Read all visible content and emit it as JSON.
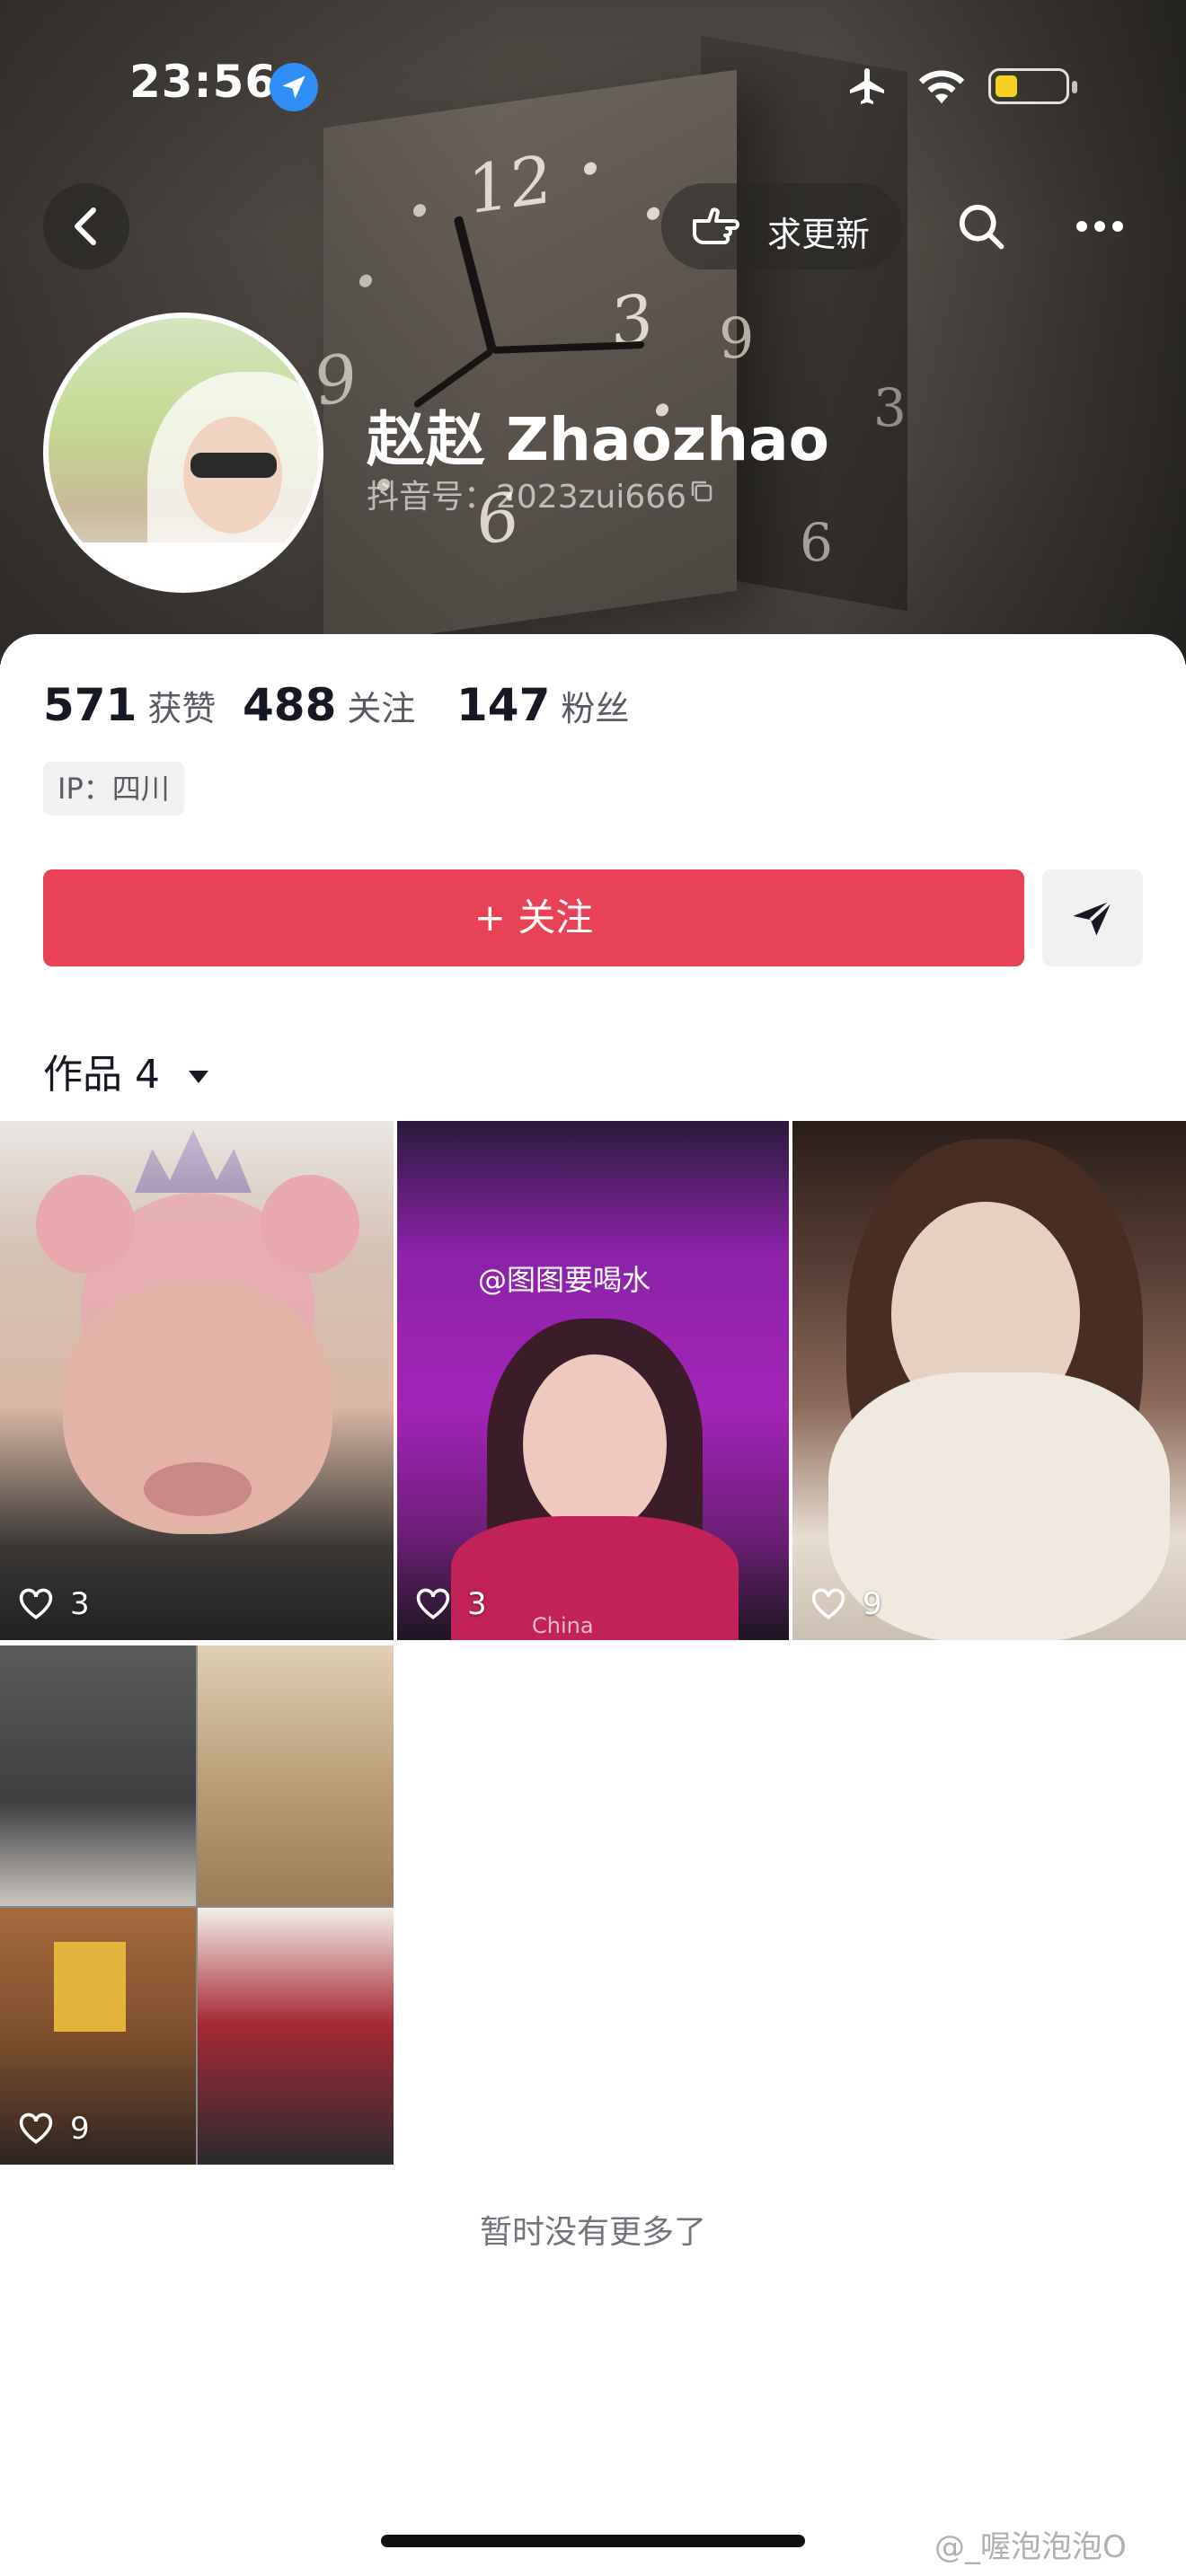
{
  "status_bar": {
    "time": "23:56"
  },
  "nav": {
    "request_update_label": "求更新"
  },
  "profile": {
    "name": "赵赵 Zhaozhao",
    "douyin_id": "抖音号：2023zui666"
  },
  "stats": [
    {
      "value": "571",
      "label": "获赞"
    },
    {
      "value": "488",
      "label": "关注"
    },
    {
      "value": "147",
      "label": "粉丝"
    }
  ],
  "ip_tag": "IP：四川",
  "actions": {
    "follow_label": "+ 关注"
  },
  "works_tab": {
    "label": "作品 4"
  },
  "videos": [
    {
      "likes": "3"
    },
    {
      "likes": "3",
      "watermark": "@图图要喝水",
      "caption": "China"
    },
    {
      "likes": "9"
    },
    {
      "likes": "9"
    }
  ],
  "end_text": "暂时没有更多了",
  "source_watermark": "@_喔泡泡泡O",
  "colors": {
    "follow_button": "#e94256",
    "ip_tag_bg": "#f1f1f2",
    "location_icon": "#2f8df6",
    "battery": "#f7d021"
  }
}
